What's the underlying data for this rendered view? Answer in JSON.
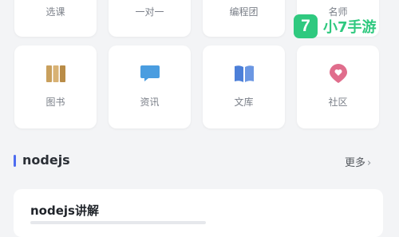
{
  "grid_top": [
    {
      "label": "选课"
    },
    {
      "label": "一对一"
    },
    {
      "label": "编程团"
    },
    {
      "label": "名师"
    }
  ],
  "grid_bottom": [
    {
      "label": "图书",
      "icon": "books-icon",
      "color": "#c9a05d"
    },
    {
      "label": "资讯",
      "icon": "chat-bubble-icon",
      "color": "#4a9de0"
    },
    {
      "label": "文库",
      "icon": "open-book-icon",
      "color": "#4c7fd8"
    },
    {
      "label": "社区",
      "icon": "heart-pin-icon",
      "color": "#e06d8c"
    }
  ],
  "section": {
    "title": "nodejs",
    "more_label": "更多",
    "accent": "#4d6cf0"
  },
  "articles": [
    {
      "title": "nodejs讲解"
    }
  ],
  "watermark": {
    "logo_char": "7",
    "text": "小7手游",
    "color": "#2fc97f"
  }
}
